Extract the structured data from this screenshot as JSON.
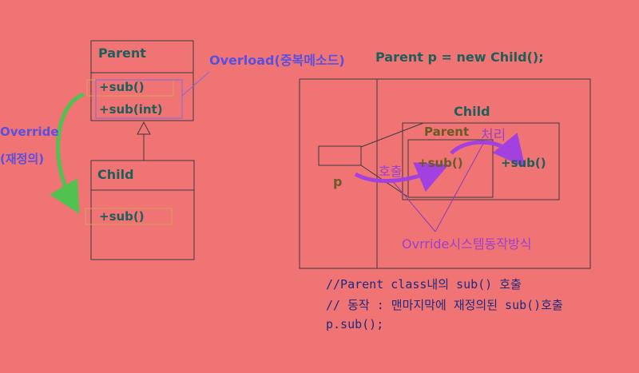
{
  "left_diagram": {
    "parent_class": "Parent",
    "parent_methods": [
      "+sub()",
      "+sub(int)"
    ],
    "child_class": "Child",
    "child_methods": [
      "+sub()"
    ],
    "overload_label": "Overload(중복메소드)",
    "override_label_1": "Override",
    "override_label_2": "(재정의)"
  },
  "right_diagram": {
    "declaration": "Parent p = new Child();",
    "child_box_title": "Child",
    "parent_box_title": "Parent",
    "process_label": "처리",
    "call_label": "호출",
    "var_label": "p",
    "parent_method": "+sub()",
    "child_method": "+sub()",
    "mechanism_label": "Ovrride시스템동작방식"
  },
  "code_lines": [
    "//Parent class내의 sub() 호출",
    "// 동작 : 맨마지막에 재정의된 sub()호출",
    "p.sub();"
  ],
  "colors": {
    "background": "#f07474",
    "box_line": "#3a3a3a",
    "teal_text": "#1f5f5a",
    "blue_text": "#5a4fe0",
    "purple_arrow": "#a340e0",
    "green_arrow": "#4fc24f"
  }
}
